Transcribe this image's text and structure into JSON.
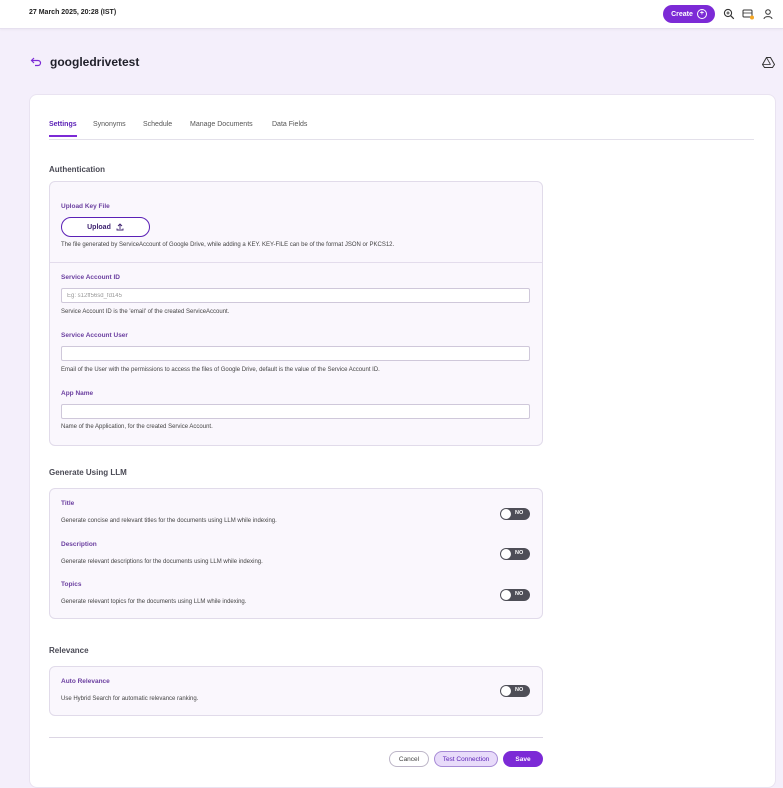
{
  "topbar": {
    "datetime": "27 March 2025, 20:28 (IST)",
    "create_label": "Create",
    "icons": [
      "search-plus-icon",
      "dashboard-icon",
      "user-icon"
    ]
  },
  "header": {
    "title": "googledrivetest",
    "back_icon": "back-arrow-icon",
    "source_icon": "google-drive-icon"
  },
  "tabs": [
    {
      "label": "Settings",
      "active": true
    },
    {
      "label": "Synonyms",
      "active": false
    },
    {
      "label": "Schedule",
      "active": false
    },
    {
      "label": "Manage Documents",
      "active": false
    },
    {
      "label": "Data Fields",
      "active": false
    }
  ],
  "authentication": {
    "title": "Authentication",
    "upload_key_label": "Upload Key File",
    "upload_button": "Upload",
    "upload_help": "The file generated by ServiceAccount of Google Drive, while adding a KEY. KEY-FILE can be of the format JSON or PKCS12.",
    "service_account_id_label": "Service Account ID",
    "service_account_id_placeholder": "Eg: s12ff56sd_fd145",
    "service_account_id_value": "",
    "service_account_id_help": "Service Account ID is the 'email' of the created ServiceAccount.",
    "service_account_user_label": "Service Account User",
    "service_account_user_value": "",
    "service_account_user_help": "Email of the User with the permissions to access the files of Google Drive, default is the value of the Service Account ID.",
    "app_name_label": "App Name",
    "app_name_value": "",
    "app_name_help": "Name of the Application, for the created Service Account."
  },
  "llm": {
    "title": "Generate Using LLM",
    "items": [
      {
        "label": "Title",
        "help": "Generate concise and relevant titles for the documents using LLM while indexing.",
        "toggle": "NO"
      },
      {
        "label": "Description",
        "help": "Generate relevant descriptions for the documents using LLM while indexing.",
        "toggle": "NO"
      },
      {
        "label": "Topics",
        "help": "Generate relevant topics for the documents using LLM while indexing.",
        "toggle": "NO"
      }
    ]
  },
  "relevance": {
    "title": "Relevance",
    "item": {
      "label": "Auto Relevance",
      "help": "Use Hybrid Search for automatic relevance ranking.",
      "toggle": "NO"
    }
  },
  "footer": {
    "cancel": "Cancel",
    "test_connection": "Test Connection",
    "save": "Save"
  },
  "colors": {
    "accent": "#7c2ad6",
    "background": "#f4effb"
  }
}
